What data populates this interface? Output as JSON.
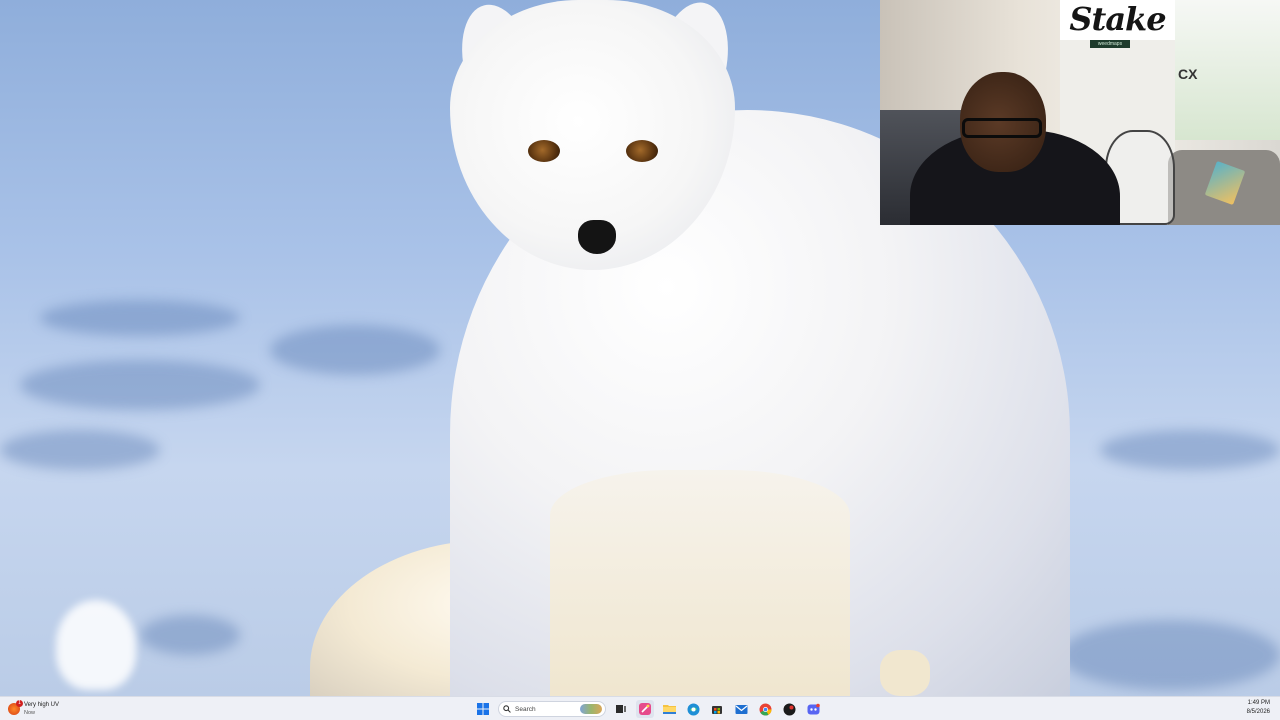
{
  "taskbar": {
    "weather": {
      "icon": "weather-sun-icon",
      "badge": "1",
      "condition": "Very high UV",
      "time": "Now"
    },
    "start_icon": "windows-start-icon",
    "search": {
      "placeholder": "Search",
      "icon": "search-icon"
    },
    "pinned_apps": [
      {
        "name": "highlighted-app-icon",
        "active": true
      },
      {
        "name": "task-view-icon"
      },
      {
        "name": "file-explorer-icon"
      },
      {
        "name": "edge-icon"
      },
      {
        "name": "store-icon"
      },
      {
        "name": "mail-icon"
      },
      {
        "name": "chrome-icon"
      },
      {
        "name": "app-icon"
      },
      {
        "name": "discord-icon"
      }
    ],
    "clock": {
      "time": "1:49 PM",
      "date": "8/5/2026"
    }
  },
  "webcam": {
    "sign_text": "Stake",
    "small_sign": "weedmaps",
    "wall_text": "CX"
  },
  "colors": {
    "taskbar_bg": "#eef0f6",
    "sky": "#a9c2e8",
    "active_app": "#e64a8b",
    "discord": "#5865f2",
    "edge": "#1f8fd6",
    "chrome_red": "#e84235"
  }
}
